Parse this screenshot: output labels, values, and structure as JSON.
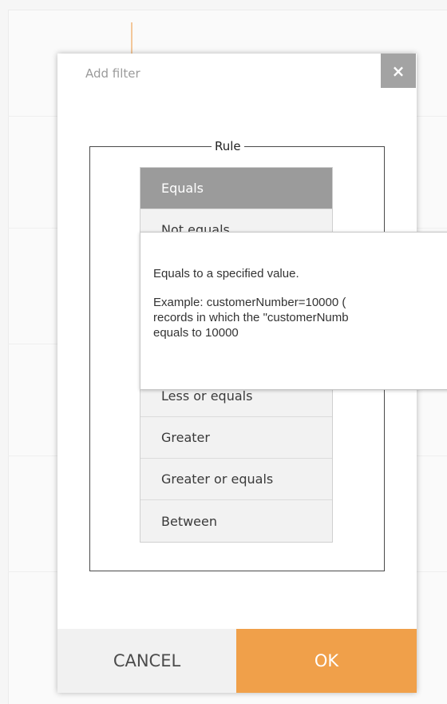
{
  "dialog": {
    "title": "Add filter",
    "close_icon": "close-icon",
    "close_glyph": "×"
  },
  "rule": {
    "legend": "Rule",
    "selected": "Equals",
    "items": [
      {
        "label": "Equals"
      },
      {
        "label": "Not equals"
      },
      {
        "label": ""
      },
      {
        "label": ""
      },
      {
        "label": ""
      },
      {
        "label": "Less or equals"
      },
      {
        "label": "Greater"
      },
      {
        "label": "Greater or equals"
      },
      {
        "label": "Between"
      }
    ]
  },
  "tooltip": {
    "line1": "Equals to a specified value.",
    "line2": "Example: customerNumber=10000 (",
    "line3": "records in which the \"customerNumb",
    "line4": "equals to 10000"
  },
  "footer": {
    "cancel_label": "CANCEL",
    "ok_label": "OK"
  },
  "colors": {
    "accent": "#f0a04a",
    "selected_item": "#9b9b9b",
    "close_bg": "#a3a3a3"
  }
}
